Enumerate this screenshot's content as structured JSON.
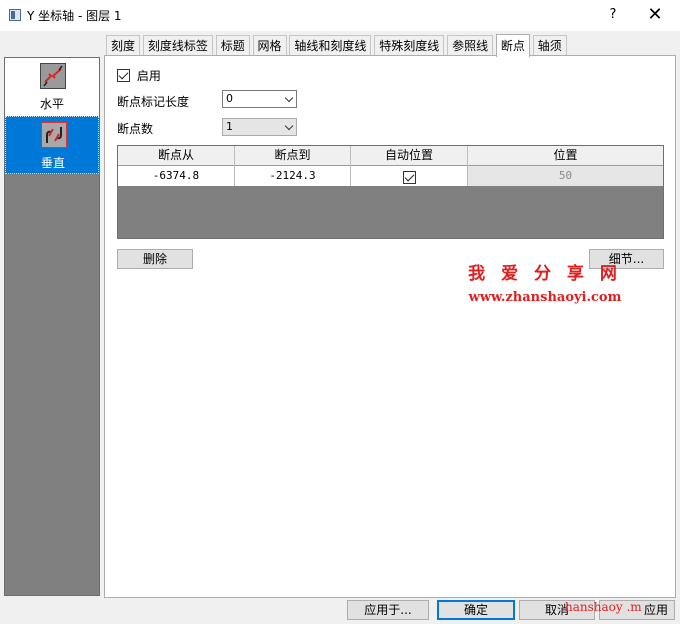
{
  "window": {
    "title": "Y 坐标轴 - 图层 1",
    "help": "?",
    "close": "✕"
  },
  "sidebar": {
    "items": [
      {
        "label": "水平",
        "icon": "horizontal-axis-break-icon",
        "selected": false
      },
      {
        "label": "垂直",
        "icon": "vertical-axis-break-icon",
        "selected": true
      }
    ]
  },
  "tabs": [
    "刻度",
    "刻度线标签",
    "标题",
    "网格",
    "轴线和刻度线",
    "特殊刻度线",
    "参照线",
    "断点",
    "轴须"
  ],
  "active_tab": "断点",
  "panel": {
    "enable_label": "启用",
    "enable_checked": true,
    "break_mark_length_label": "断点标记长度",
    "break_mark_length_value": "0",
    "break_count_label": "断点数",
    "break_count_value": "1",
    "table": {
      "headers": [
        "断点从",
        "断点到",
        "自动位置",
        "位置"
      ],
      "rows": [
        {
          "from": "-6374.8",
          "to": "-2124.3",
          "auto": true,
          "position": "50"
        }
      ]
    },
    "delete_button": "删除",
    "details_button": "细节..."
  },
  "watermark": {
    "line1": "我 爱 分 享 网",
    "line2": "www.zhanshaoyi.com",
    "bottom": "hanshaoy .m"
  },
  "footer": {
    "apply_to": "应用于...",
    "ok": "确定",
    "cancel": "取消",
    "apply": "应用"
  },
  "colors": {
    "selection": "#0078d7",
    "watermark": "#e02020"
  }
}
